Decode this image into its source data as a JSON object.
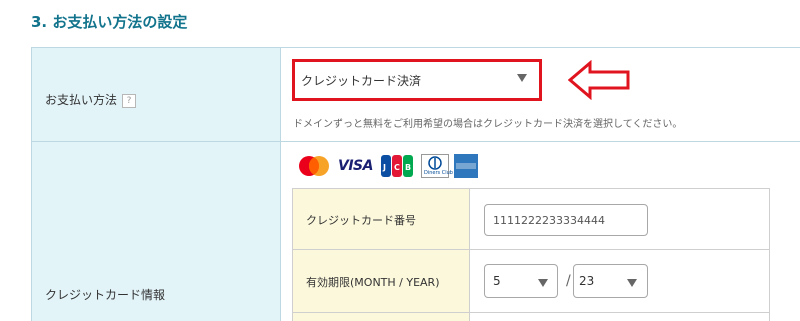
{
  "section_title": "3. お支払い方法の設定",
  "payment": {
    "label": "お支払い方法",
    "help": "?",
    "selected": "クレジットカード決済",
    "note": "ドメインずっと無料をご利用希望の場合はクレジットカード決済を選択してください。"
  },
  "credit": {
    "label": "クレジットカード情報",
    "card_number_label": "クレジットカード番号",
    "card_number_value": "1111222233334444",
    "expiry_label": "有効期限(MONTH / YEAR)",
    "expiry_month": "5",
    "expiry_separator": "/",
    "expiry_year": "23",
    "card_brands": [
      "mastercard-icon",
      "visa-icon",
      "jcb-icon",
      "diners-club-icon",
      "amex-icon"
    ],
    "diners_text": "Diners Club",
    "visa_text": "VISA",
    "jcb_text": "JCB"
  },
  "colors": {
    "accent_title": "#12748c",
    "label_bg": "#e3f4f9",
    "highlight": "#e0141e",
    "inner_label_bg": "#fcf8dc"
  }
}
